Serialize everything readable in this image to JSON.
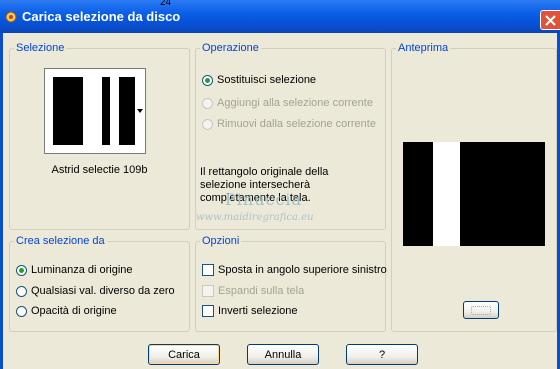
{
  "window": {
    "title": "Carica selezione da disco",
    "top_number": "24"
  },
  "selezione": {
    "legend": "Selezione",
    "file_name": "Astrid selectie 109b"
  },
  "operazione": {
    "legend": "Operazione",
    "options": [
      {
        "label": "Sostituisci selezione",
        "checked": true,
        "enabled": true
      },
      {
        "label": "Aggiungi alla selezione corrente",
        "checked": false,
        "enabled": false
      },
      {
        "label": "Rimuovi dalla selezione corrente",
        "checked": false,
        "enabled": false
      }
    ],
    "info": "Il rettangolo originale della selezione intersecherà completamente la tela."
  },
  "anteprima": {
    "legend": "Anteprima"
  },
  "watermark": {
    "line1": "Pinuccia",
    "line2": "www.maidiregrafica.eu"
  },
  "crea": {
    "legend": "Crea selezione da",
    "options": [
      {
        "label": "Luminanza di origine",
        "checked": true
      },
      {
        "label": "Qualsiasi val. diverso da zero",
        "checked": false
      },
      {
        "label": "Opacità di origine",
        "checked": false
      }
    ]
  },
  "opzioni": {
    "legend": "Opzioni",
    "options": [
      {
        "label": "Sposta in angolo superiore sinistro",
        "checked": false,
        "enabled": true
      },
      {
        "label": "Espandi sulla tela",
        "checked": false,
        "enabled": false
      },
      {
        "label": "Inverti selezione",
        "checked": false,
        "enabled": true
      }
    ]
  },
  "buttons": {
    "ok": "Carica",
    "cancel": "Annulla",
    "help": "?"
  },
  "colors": {
    "title_bar": "#0a5fe6",
    "legend_text": "#0046d5",
    "dialog_bg": "#ece9d8"
  }
}
